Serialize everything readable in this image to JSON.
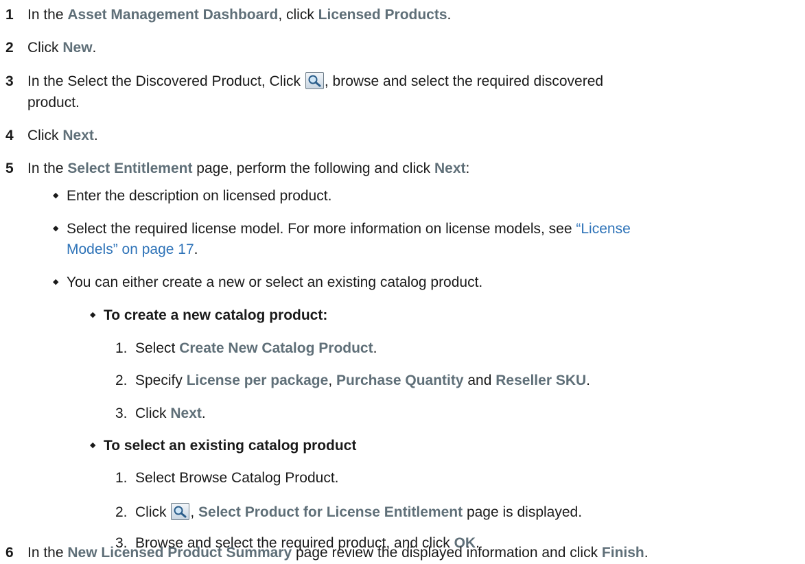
{
  "steps": [
    {
      "num": "1",
      "parts": [
        "In the ",
        "Asset Management Dashboard",
        ", click ",
        "Licensed Products",
        "."
      ]
    },
    {
      "num": "2",
      "parts": [
        "Click ",
        "New",
        "."
      ]
    },
    {
      "num": "3",
      "parts": [
        "In the Select the Discovered Product, Click ",
        ", browse and select the required discovered",
        "product."
      ]
    },
    {
      "num": "4",
      "parts": [
        "Click ",
        "Next",
        "."
      ]
    },
    {
      "num": "5",
      "parts": [
        "In the ",
        "Select Entitlement",
        " page, perform the following and click ",
        "Next",
        ":"
      ]
    },
    {
      "num": "6",
      "parts": [
        "In the ",
        "New Licensed Product Summary",
        " page review the displayed information and click ",
        "Finish",
        "."
      ]
    }
  ],
  "step5_bullets": {
    "b1": "Enter the description on licensed product.",
    "b2_text": "Select the required license model. For more information on license models, see ",
    "b2_link_line1": "“License",
    "b2_link_line2": "Models” on page 17",
    "b2_end": ".",
    "b3": "You can either create a new or select an existing catalog product."
  },
  "create_new": {
    "heading": "To create a new catalog product:",
    "s1": [
      "1.",
      "Select ",
      "Create New Catalog Product",
      "."
    ],
    "s2": [
      "2.",
      "Specify ",
      "License per package",
      ", ",
      "Purchase Quantity",
      " and ",
      "Reseller SKU",
      "."
    ],
    "s3": [
      "3.",
      "Click ",
      "Next",
      "."
    ]
  },
  "select_existing": {
    "heading": "To select an existing catalog product",
    "s1": [
      "1.",
      "Select Browse Catalog Product."
    ],
    "s2": [
      "2.",
      "Click ",
      ", ",
      "Select Product for License Entitlement",
      " page is displayed."
    ],
    "s3": [
      "3.",
      "Browse and select the required product, and click ",
      "OK",
      "."
    ]
  },
  "icons": {
    "search": "magnifier-search-icon",
    "bullet": "diamond-bullet-icon"
  }
}
